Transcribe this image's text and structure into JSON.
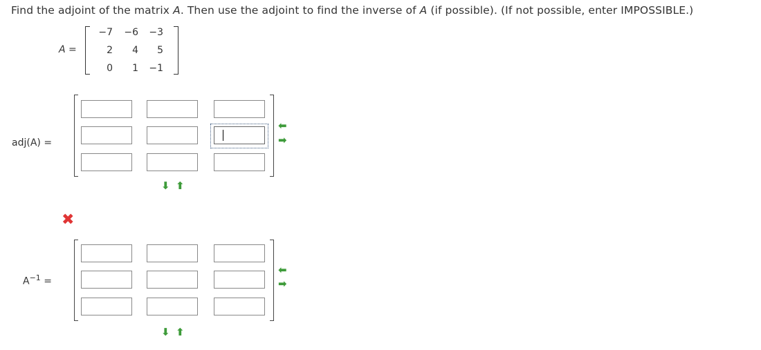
{
  "prompt": {
    "part1": "Find the adjoint of the matrix ",
    "var": "A",
    "part2": ". Then use the adjoint to find the inverse of ",
    "var2": "A",
    "part3": " (if possible). (If not possible, enter IMPOSSIBLE.)"
  },
  "matrix_a": {
    "label_var": "A",
    "label_eq": "=",
    "rows": [
      [
        "−7",
        "−6",
        "−3"
      ],
      [
        "2",
        "4",
        "5"
      ],
      [
        "0",
        "1",
        "−1"
      ]
    ]
  },
  "adj": {
    "label": "adj(A)",
    "label_eq": "=",
    "values": [
      "",
      "",
      "",
      "",
      "",
      "",
      "",
      "",
      ""
    ],
    "grow_rows_icon": "arrow-left-icon",
    "shrink_rows_icon": "arrow-right-icon",
    "grow_cols_icon": "arrow-down-icon",
    "shrink_cols_icon": "arrow-up-icon"
  },
  "result_status": "incorrect",
  "inverse": {
    "label_base": "A",
    "label_exp": "−1",
    "label_eq": "=",
    "values": [
      "",
      "",
      "",
      "",
      "",
      "",
      "",
      "",
      ""
    ]
  },
  "colors": {
    "arrow": "#3e9b3a",
    "error": "#e03535",
    "focus": "#3d5a80"
  }
}
